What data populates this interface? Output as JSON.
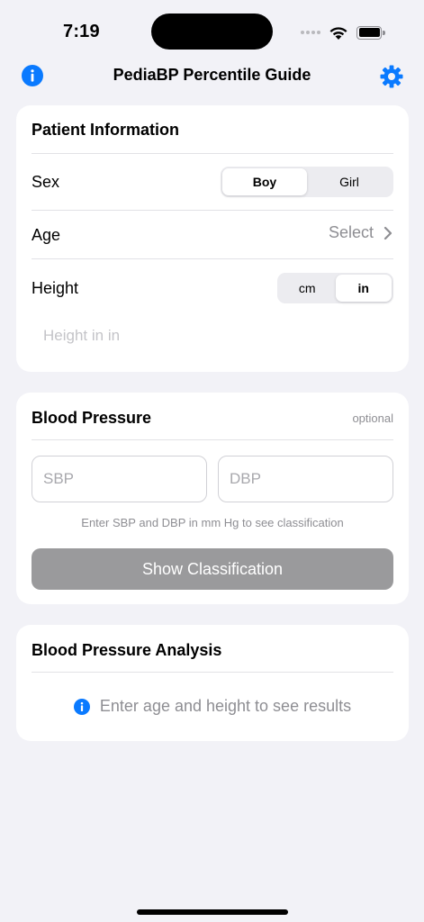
{
  "status_bar": {
    "time": "7:19"
  },
  "nav": {
    "title": "PediaBP Percentile Guide",
    "info_icon": "info-icon",
    "settings_icon": "gear-icon"
  },
  "patient": {
    "title": "Patient Information",
    "sex_label": "Sex",
    "sex_options": [
      "Boy",
      "Girl"
    ],
    "sex_selected": "Boy",
    "age_label": "Age",
    "age_value": "Select",
    "height_label": "Height",
    "height_units": [
      "cm",
      "in"
    ],
    "height_unit_selected": "in",
    "height_placeholder": "Height in in"
  },
  "bp": {
    "title": "Blood Pressure",
    "optional_label": "optional",
    "sbp_placeholder": "SBP",
    "dbp_placeholder": "DBP",
    "hint": "Enter SBP and DBP in mm Hg to see classification",
    "button_label": "Show Classification"
  },
  "analysis": {
    "title": "Blood Pressure Analysis",
    "message": "Enter age and height to see results"
  },
  "colors": {
    "accent": "#0a7aff",
    "background": "#f2f2f7",
    "disabled_button": "#9a9a9c"
  }
}
